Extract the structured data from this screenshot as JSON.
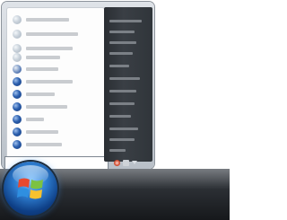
{
  "start_menu": {
    "programs": [
      {
        "icon": "program-icon-light",
        "style": "light"
      },
      {
        "icon": "program-icon-light",
        "style": "light"
      },
      {
        "icon": "program-icon-light",
        "style": "light"
      },
      {
        "icon": "program-icon-light",
        "style": "light"
      },
      {
        "icon": "program-icon-half",
        "style": "half"
      },
      {
        "icon": "program-icon-dark",
        "style": "dark"
      },
      {
        "icon": "program-icon-dark",
        "style": "dark"
      },
      {
        "icon": "program-icon-dark",
        "style": "dark"
      },
      {
        "icon": "program-icon-dark",
        "style": "dark"
      },
      {
        "icon": "program-icon-dark",
        "style": "dark"
      }
    ],
    "search_value": "",
    "right_items_count": 12
  },
  "taskbar": {
    "start_button_icon": "windows-logo-icon"
  },
  "colors": {
    "logo_red": "#e8492f",
    "logo_green": "#7cc242",
    "logo_blue": "#2f8fe0",
    "logo_yellow": "#f7c22e"
  }
}
